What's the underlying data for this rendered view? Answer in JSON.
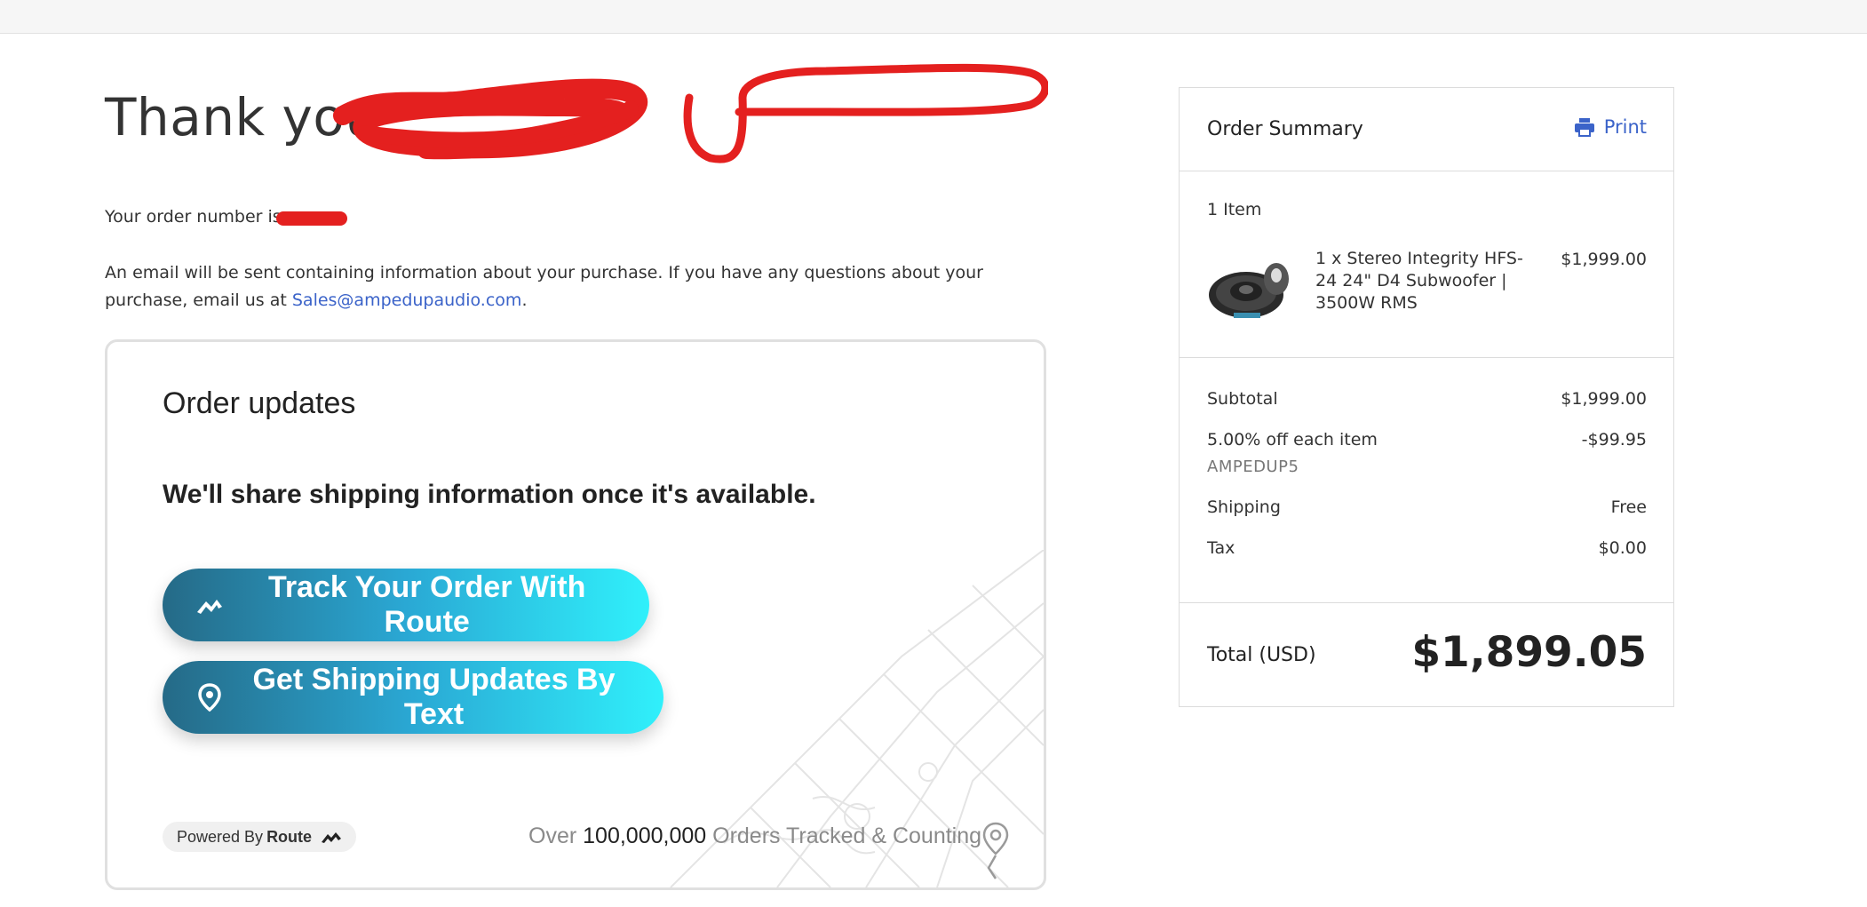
{
  "header": {
    "thank_you": "Thank you",
    "order_number_label": "Your order number is",
    "email_text": "An email will be sent containing information about your purchase. If you have any questions about your purchase, email us at ",
    "email_link": "Sales@ampedupaudio.com",
    "email_end": "."
  },
  "order_updates": {
    "title": "Order updates",
    "subtitle": "We'll share shipping information once it's available.",
    "track_button": "Track Your Order With Route",
    "text_button": "Get Shipping Updates By Text",
    "powered_by": "Powered By",
    "powered_brand": "Route",
    "counter_prefix": "Over",
    "counter_number": "100,000,000",
    "counter_suffix": "Orders Tracked & Counting",
    "button_gradient": [
      "#256a87",
      "#30f0fb"
    ]
  },
  "summary": {
    "title": "Order Summary",
    "print": "Print",
    "items_count": "1 Item",
    "item": {
      "name": "1 x Stereo Integrity HFS-24 24\" D4 Subwoofer | 3500W RMS",
      "price": "$1,999.00"
    },
    "subtotal_label": "Subtotal",
    "subtotal_value": "$1,999.00",
    "discount_label": "5.00% off each item",
    "discount_value": "-$99.95",
    "discount_code": "AMPEDUP5",
    "shipping_label": "Shipping",
    "shipping_value": "Free",
    "tax_label": "Tax",
    "tax_value": "$0.00",
    "total_label": "Total (USD)",
    "total_value": "$1,899.05"
  },
  "colors": {
    "link": "#3b63c9",
    "redaction": "#e4201f"
  }
}
